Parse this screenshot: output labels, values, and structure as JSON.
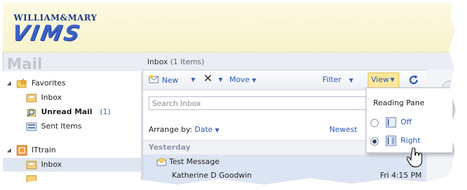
{
  "logo": {
    "line1": "WILLIAM&MARY",
    "line2": "VIMS"
  },
  "mail_title": "Mail",
  "nav": {
    "favorites": "Favorites",
    "items": [
      {
        "label": "Inbox"
      },
      {
        "label": "Unread Mail",
        "count": "(1)"
      },
      {
        "label": "Sent Items"
      }
    ],
    "account": "ITtrain",
    "account_items": [
      {
        "label": "Inbox"
      }
    ]
  },
  "main": {
    "header": {
      "title": "Inbox",
      "count": "(1 Items)"
    },
    "toolbar": {
      "new": "New",
      "move": "Move",
      "filter": "Filter",
      "view": "View"
    },
    "search_placeholder": "Search Inbox",
    "arrange_label": "Arrange by:",
    "arrange_value": "Date",
    "sort": "Newest",
    "group": "Yesterday",
    "message": {
      "subject": "Test Message",
      "from": "Katherine D Goodwin",
      "time": "Fri 4:15 PM"
    }
  },
  "view_menu": {
    "heading": "Reading Pane",
    "options": [
      {
        "label": "Off",
        "selected": false
      },
      {
        "label": "Right",
        "selected": true
      }
    ]
  },
  "colors": {
    "accent": "#2a56b4",
    "highlight": "#fbe79a",
    "selection": "#dbe4f2"
  }
}
